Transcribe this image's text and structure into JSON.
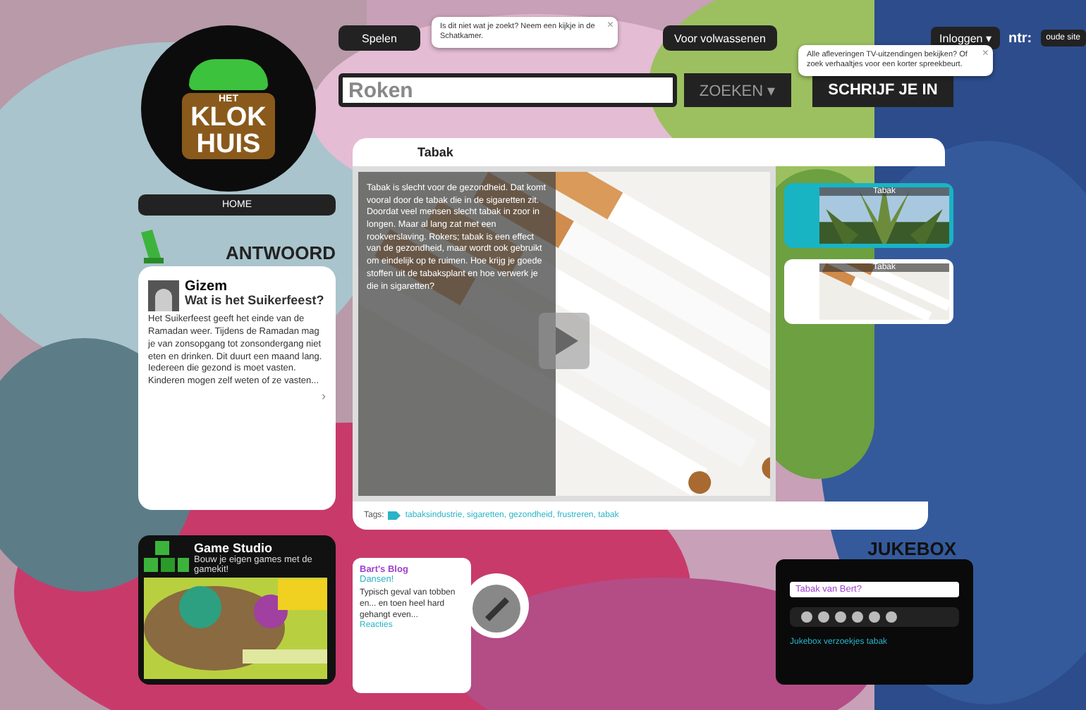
{
  "logo": {
    "lines": [
      "HET",
      "KLOK",
      "HUIS"
    ]
  },
  "nav": {
    "items": [
      {
        "label": "Spelen"
      },
      {
        "label": "Voor volwassenen"
      }
    ],
    "login": "Inloggen ▾",
    "broadcaster": "ntr:",
    "old_site": "oude site"
  },
  "search": {
    "value": "Roken",
    "button": "ZOEKEN ▾",
    "signup": "SCHRIJF JE IN"
  },
  "tooltips": [
    {
      "text": "Is dit niet wat je zoekt? Neem een kijkje in de Schatkamer.",
      "close": "×"
    },
    {
      "text": "Alle afleveringen TV-uitzendingen bekijken? Of zoek verhaaltjes voor een korter spreekbeurt.",
      "close": "×"
    }
  ],
  "home": "HOME",
  "answer": {
    "heading": "ANTWOORD",
    "name": "Gizem",
    "question": "Wat is het Suikerfeest?",
    "text": "Het Suikerfeest geeft het einde van de Ramadan weer. Tijdens de Ramadan mag je van zonsopgang tot zonsondergang niet eten en drinken. Dit duurt een maand lang. Iedereen die gezond is moet vasten. Kinderen mogen zelf weten of ze vasten...",
    "more": "›"
  },
  "video": {
    "title": "Tabak",
    "description": "Tabak is slecht voor de gezondheid. Dat komt vooral door de tabak die in de sigaretten zit. Doordat veel mensen slecht tabak in zoor in longen. Maar al lang zat met een rookverslaving. Rokers; tabak is een effect van de gezondheid, maar wordt ook gebruikt om eindelijk op te ruimen. Hoe krijg je goede stoffen uit de tabaksplant en hoe verwerk je die in sigaretten?",
    "tags_label": "Tags:",
    "tags": "tabaksindustrie, sigaretten, gezondheid, frustreren, tabak"
  },
  "thumbnails": [
    {
      "title": "Tabak",
      "selected": true
    },
    {
      "title": "Tabak",
      "selected": false
    }
  ],
  "game_studio": {
    "title": "Game Studio",
    "subtitle": "Bouw je eigen games met de gamekit!"
  },
  "blog": {
    "title": "Bart's Blog",
    "subtitle": "Dansen!",
    "text": "Typisch geval van tobben en... en toen heel hard gehangt even...",
    "link": "Reacties"
  },
  "jukebox": {
    "heading": "JUKEBOX",
    "track": "Tabak van Bert?",
    "link": "Jukebox verzoekjes tabak"
  }
}
